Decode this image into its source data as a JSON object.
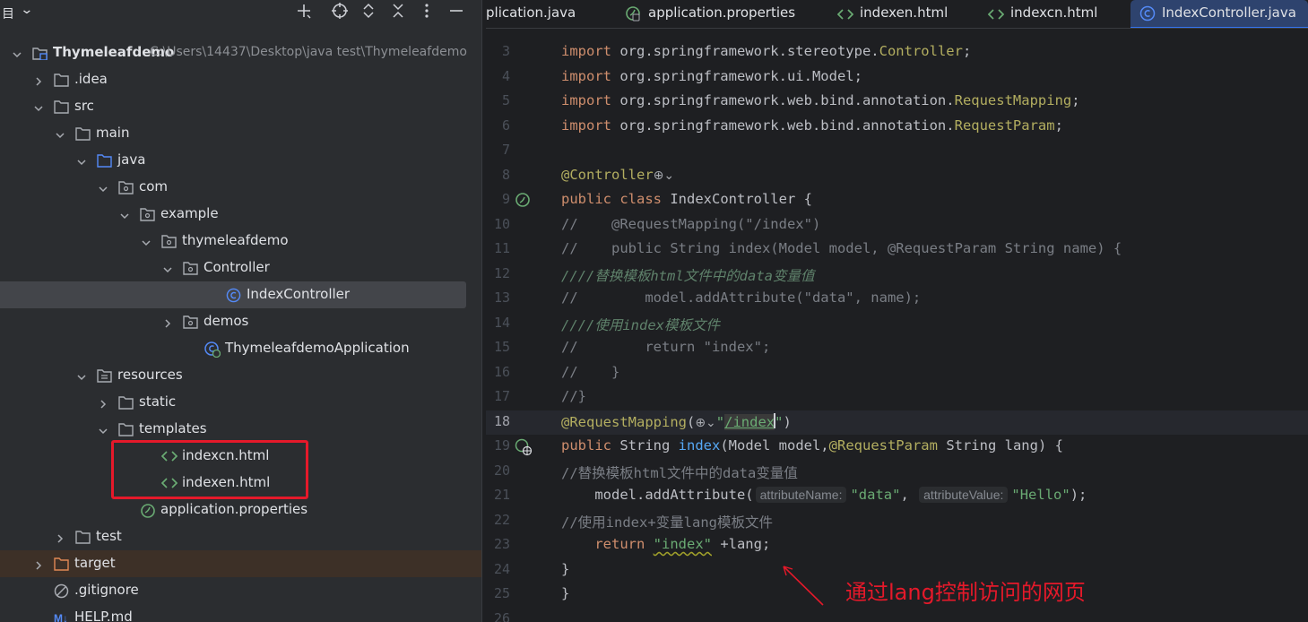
{
  "project_panel": {
    "title": "目",
    "tree": [
      {
        "label": "Thymeleafdemo",
        "path": "C:\\Users\\14437\\Desktop\\java test\\Thymeleafdemo",
        "icon": "project-module-icon",
        "expanded": true
      },
      {
        "label": ".idea",
        "icon": "folder-icon",
        "expanded": false
      },
      {
        "label": "src",
        "icon": "folder-icon",
        "expanded": true
      },
      {
        "label": "main",
        "icon": "folder-icon",
        "expanded": true
      },
      {
        "label": "java",
        "icon": "source-folder-icon",
        "expanded": true
      },
      {
        "label": "com",
        "icon": "package-icon",
        "expanded": true
      },
      {
        "label": "example",
        "icon": "package-icon",
        "expanded": true
      },
      {
        "label": "thymeleafdemo",
        "icon": "package-icon",
        "expanded": true
      },
      {
        "label": "Controller",
        "icon": "package-icon",
        "expanded": true
      },
      {
        "label": "IndexController",
        "icon": "java-class-icon",
        "selected": true
      },
      {
        "label": "demos",
        "icon": "package-icon",
        "expanded": false
      },
      {
        "label": "ThymeleafdemoApplication",
        "icon": "spring-boot-class-icon"
      },
      {
        "label": "resources",
        "icon": "resources-folder-icon",
        "expanded": true
      },
      {
        "label": "static",
        "icon": "folder-icon",
        "expanded": false
      },
      {
        "label": "templates",
        "icon": "folder-icon",
        "expanded": true
      },
      {
        "label": "indexcn.html",
        "icon": "html-file-icon"
      },
      {
        "label": "indexen.html",
        "icon": "html-file-icon"
      },
      {
        "label": "application.properties",
        "icon": "spring-properties-icon"
      },
      {
        "label": "test",
        "icon": "folder-icon",
        "expanded": false
      },
      {
        "label": "target",
        "icon": "excluded-folder-icon",
        "expanded": false
      },
      {
        "label": ".gitignore",
        "icon": "ignore-file-icon"
      },
      {
        "label": "HELP.md",
        "icon": "markdown-file-icon"
      }
    ]
  },
  "tabs": [
    {
      "label": "plication.java",
      "icon": ""
    },
    {
      "label": "application.properties",
      "icon": "spring-properties-icon"
    },
    {
      "label": "indexen.html",
      "icon": "html-file-icon"
    },
    {
      "label": "indexcn.html",
      "icon": "html-file-icon"
    },
    {
      "label": "IndexController.java",
      "icon": "java-class-icon",
      "active": true
    }
  ],
  "editor": {
    "lines": [
      {
        "n": "3",
        "segs": [
          [
            "kw",
            "import "
          ],
          [
            "",
            "org.springframework.stereotype."
          ],
          [
            "ann",
            "Controller"
          ],
          [
            "",
            ";"
          ]
        ]
      },
      {
        "n": "4",
        "segs": [
          [
            "kw",
            "import "
          ],
          [
            "",
            "org.springframework.ui.Model;"
          ]
        ]
      },
      {
        "n": "5",
        "segs": [
          [
            "kw",
            "import "
          ],
          [
            "",
            "org.springframework.web.bind.annotation."
          ],
          [
            "ann",
            "RequestMapping"
          ],
          [
            "",
            ";"
          ]
        ]
      },
      {
        "n": "6",
        "segs": [
          [
            "kw",
            "import "
          ],
          [
            "",
            "org.springframework.web.bind.annotation."
          ],
          [
            "ann",
            "RequestParam"
          ],
          [
            "",
            ";"
          ]
        ]
      },
      {
        "n": "7",
        "segs": []
      },
      {
        "n": "8",
        "segs": [
          [
            "ann",
            "@Controller"
          ],
          [
            "globe",
            "⊕⌄"
          ]
        ]
      },
      {
        "n": "9",
        "segs": [
          [
            "kw",
            "public class "
          ],
          [
            "",
            "IndexController {"
          ]
        ],
        "gutter": "spring-bean-icon"
      },
      {
        "n": "10",
        "segs": [
          [
            "cmt",
            "//    @RequestMapping(\"/index\")"
          ]
        ]
      },
      {
        "n": "11",
        "segs": [
          [
            "cmt",
            "//    public String index(Model model, @RequestParam String name) {"
          ]
        ]
      },
      {
        "n": "12",
        "segs": [
          [
            "cmt-i",
            "////替换模板html文件中的data变量值"
          ]
        ]
      },
      {
        "n": "13",
        "segs": [
          [
            "cmt",
            "//        model.addAttribute(\"data\", name);"
          ]
        ]
      },
      {
        "n": "14",
        "segs": [
          [
            "cmt-i",
            "////使用index模板文件"
          ]
        ]
      },
      {
        "n": "15",
        "segs": [
          [
            "cmt",
            "//        return \"index\";"
          ]
        ]
      },
      {
        "n": "16",
        "segs": [
          [
            "cmt",
            "//    }"
          ]
        ]
      },
      {
        "n": "17",
        "segs": [
          [
            "cmt",
            "//}"
          ]
        ]
      },
      {
        "n": "18",
        "segs": [
          [
            "ann",
            "@RequestMapping"
          ],
          [
            "",
            "("
          ],
          [
            "globe",
            "⊕⌄"
          ],
          [
            "str",
            "\""
          ],
          [
            "url",
            "/index"
          ],
          [
            "caret",
            ""
          ],
          [
            "str",
            "\""
          ],
          [
            "",
            ")"
          ]
        ],
        "active": true
      },
      {
        "n": "19",
        "segs": [
          [
            "kw",
            "public "
          ],
          [
            "",
            "String "
          ],
          [
            "fn",
            "index"
          ],
          [
            "",
            "(Model model,"
          ],
          [
            "ann",
            "@RequestParam"
          ],
          [
            "",
            " String lang) {"
          ]
        ],
        "gutter": "spring-request-mapping-icon"
      },
      {
        "n": "20",
        "segs": [
          [
            "cmt",
            "//替换模板html文件中的data变量值"
          ]
        ]
      },
      {
        "n": "21",
        "segs": [
          [
            "",
            "    model.addAttribute("
          ],
          [
            "hint",
            "attributeName:"
          ],
          [
            "str",
            "\"data\""
          ],
          [
            "",
            ", "
          ],
          [
            "hint",
            "attributeValue:"
          ],
          [
            "str",
            "\"Hello\""
          ],
          [
            "",
            ");"
          ]
        ]
      },
      {
        "n": "22",
        "segs": [
          [
            "cmt",
            "//使用index+变量lang模板文件"
          ]
        ]
      },
      {
        "n": "23",
        "segs": [
          [
            "",
            "    "
          ],
          [
            "kw",
            "return "
          ],
          [
            "str-sq",
            "\"index\""
          ],
          [
            "",
            " +lang;"
          ]
        ]
      },
      {
        "n": "24",
        "segs": [
          [
            "",
            "}"
          ]
        ]
      },
      {
        "n": "25",
        "segs": [
          [
            "",
            "}"
          ]
        ]
      },
      {
        "n": "26",
        "segs": []
      }
    ]
  },
  "annotation": {
    "text": "通过lang控制访问的网页",
    "color": "#e5192a"
  }
}
